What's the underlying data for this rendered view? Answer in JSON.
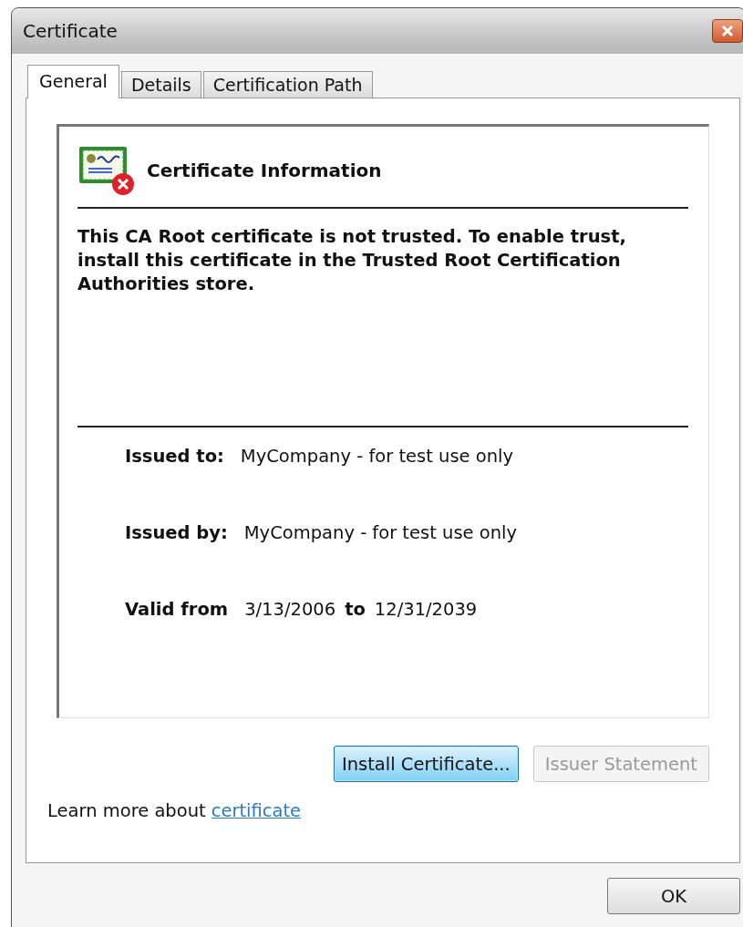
{
  "window": {
    "title": "Certificate"
  },
  "tabs": [
    {
      "label": "General",
      "selected": true
    },
    {
      "label": "Details",
      "selected": false
    },
    {
      "label": "Certification Path",
      "selected": false
    }
  ],
  "info": {
    "heading": "Certificate Information",
    "message": "This CA Root certificate is not trusted. To enable trust, install this certificate in the Trusted Root Certification Authorities store.",
    "fields": [
      {
        "label": "Issued to:",
        "value": "MyCompany - for test use only"
      },
      {
        "label": "Issued by:",
        "value": "MyCompany - for test use only"
      }
    ],
    "validity": {
      "from_label": "Valid from",
      "from": "3/13/2006",
      "to_label": "to",
      "to": "12/31/2039"
    }
  },
  "buttons": [
    {
      "label": "Install Certificate...",
      "disabled": false,
      "focused": true
    },
    {
      "label": "Issuer Statement",
      "disabled": true,
      "focused": false
    }
  ],
  "learn_more": {
    "text": "Learn more about",
    "link": "certificate"
  },
  "ok_button": {
    "label": "OK"
  }
}
